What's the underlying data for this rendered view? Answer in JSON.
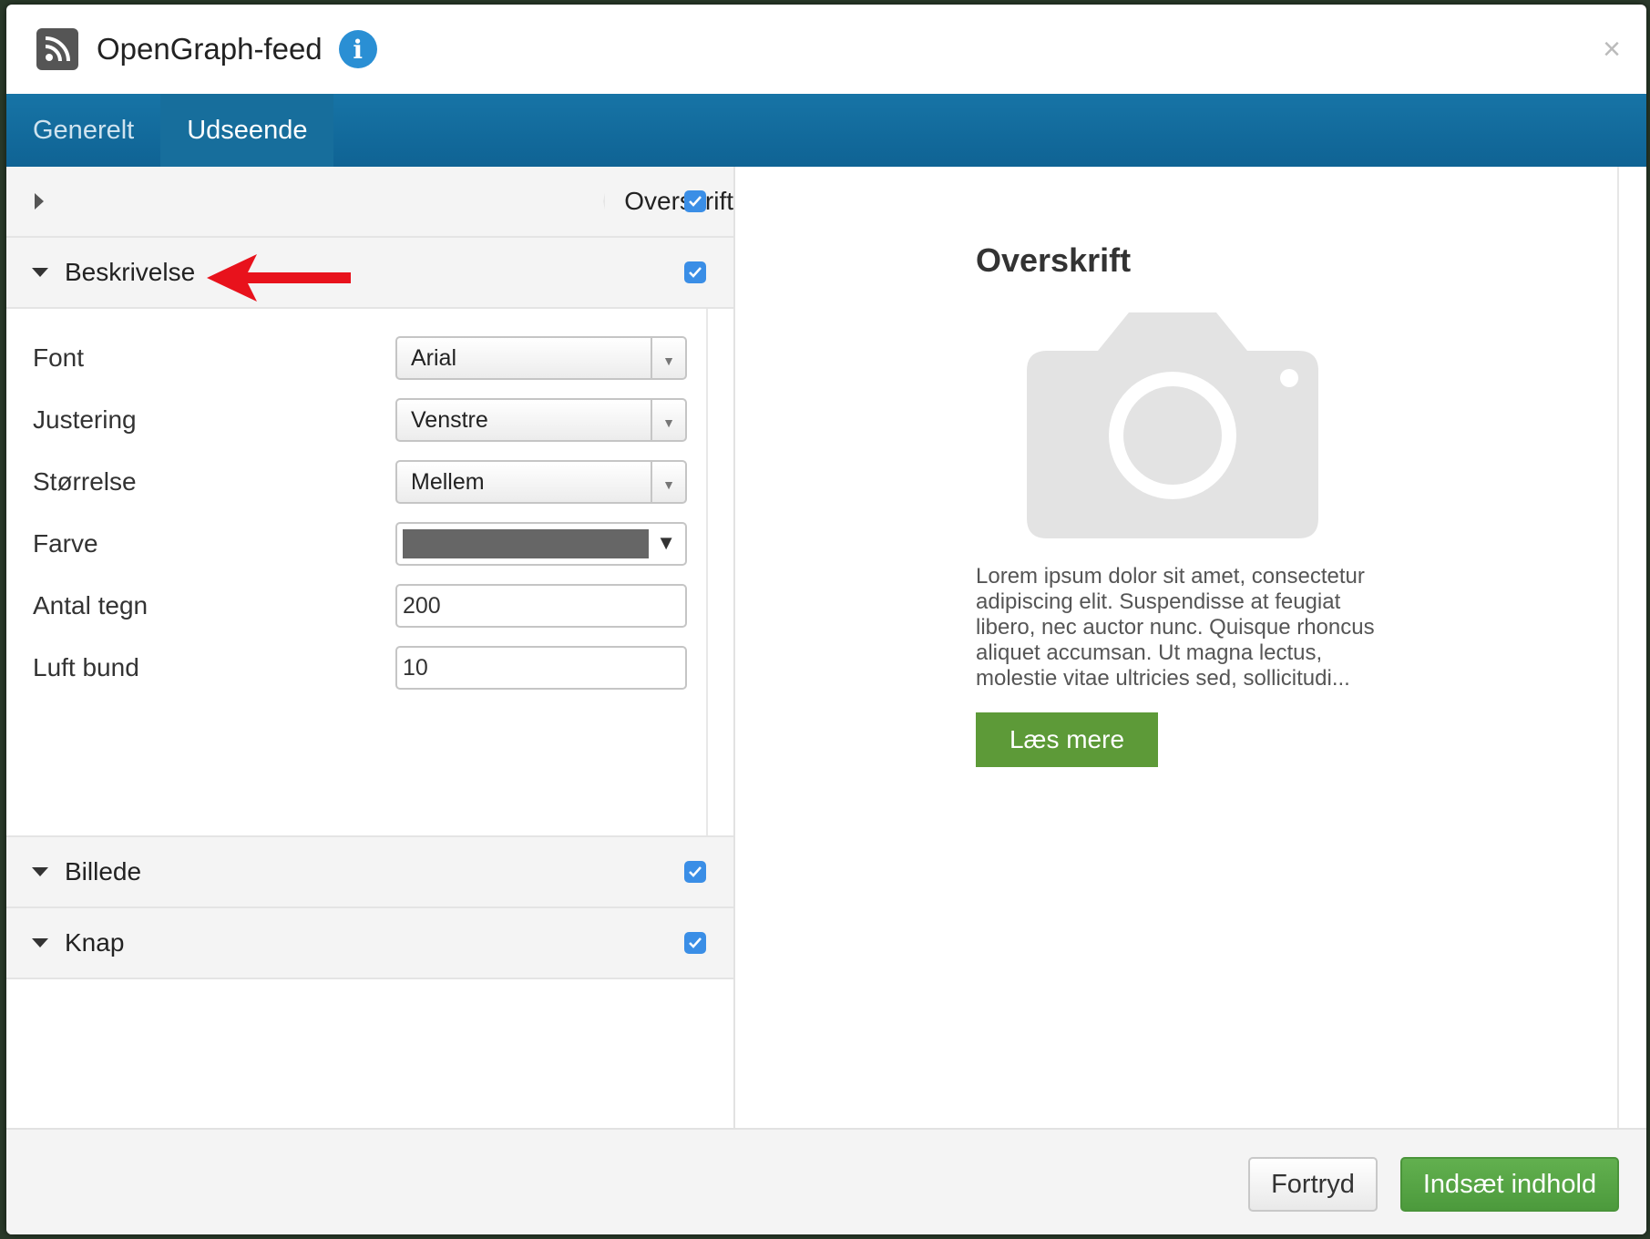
{
  "header": {
    "title": "OpenGraph-feed",
    "info_icon": "i",
    "close_icon": "×"
  },
  "tabs": [
    {
      "label": "Generelt",
      "active": false
    },
    {
      "label": "Udseende",
      "active": true
    }
  ],
  "sections": {
    "overskrift": {
      "label": "Overskrift",
      "checked": true,
      "expanded": false
    },
    "beskrivelse": {
      "label": "Beskrivelse",
      "checked": true,
      "expanded": true
    },
    "billede": {
      "label": "Billede",
      "checked": true,
      "expanded": true
    },
    "knap": {
      "label": "Knap",
      "checked": true,
      "expanded": true
    }
  },
  "form": {
    "font": {
      "label": "Font",
      "value": "Arial"
    },
    "justering": {
      "label": "Justering",
      "value": "Venstre"
    },
    "storrelse": {
      "label": "Størrelse",
      "value": "Mellem"
    },
    "farve": {
      "label": "Farve",
      "color": "#666666"
    },
    "antal_tegn": {
      "label": "Antal tegn",
      "value": "200"
    },
    "luft_bund": {
      "label": "Luft bund",
      "value": "10"
    }
  },
  "preview": {
    "title": "Overskrift",
    "text": "Lorem ipsum dolor sit amet, consectetur adipiscing elit. Suspendisse at feugiat libero, nec auctor nunc. Quisque rhoncus aliquet accumsan. Ut magna lectus, molestie vitae ultricies sed, sollicitudi...",
    "button": "Læs mere",
    "button_color": "#5d9a38"
  },
  "footer": {
    "cancel": "Fortryd",
    "insert": "Indsæt indhold"
  },
  "colors": {
    "tab_bar": "#1774a6",
    "checkbox": "#3a8ee6",
    "insert_button": "#55a443",
    "annotation_arrow": "#e8121c"
  }
}
